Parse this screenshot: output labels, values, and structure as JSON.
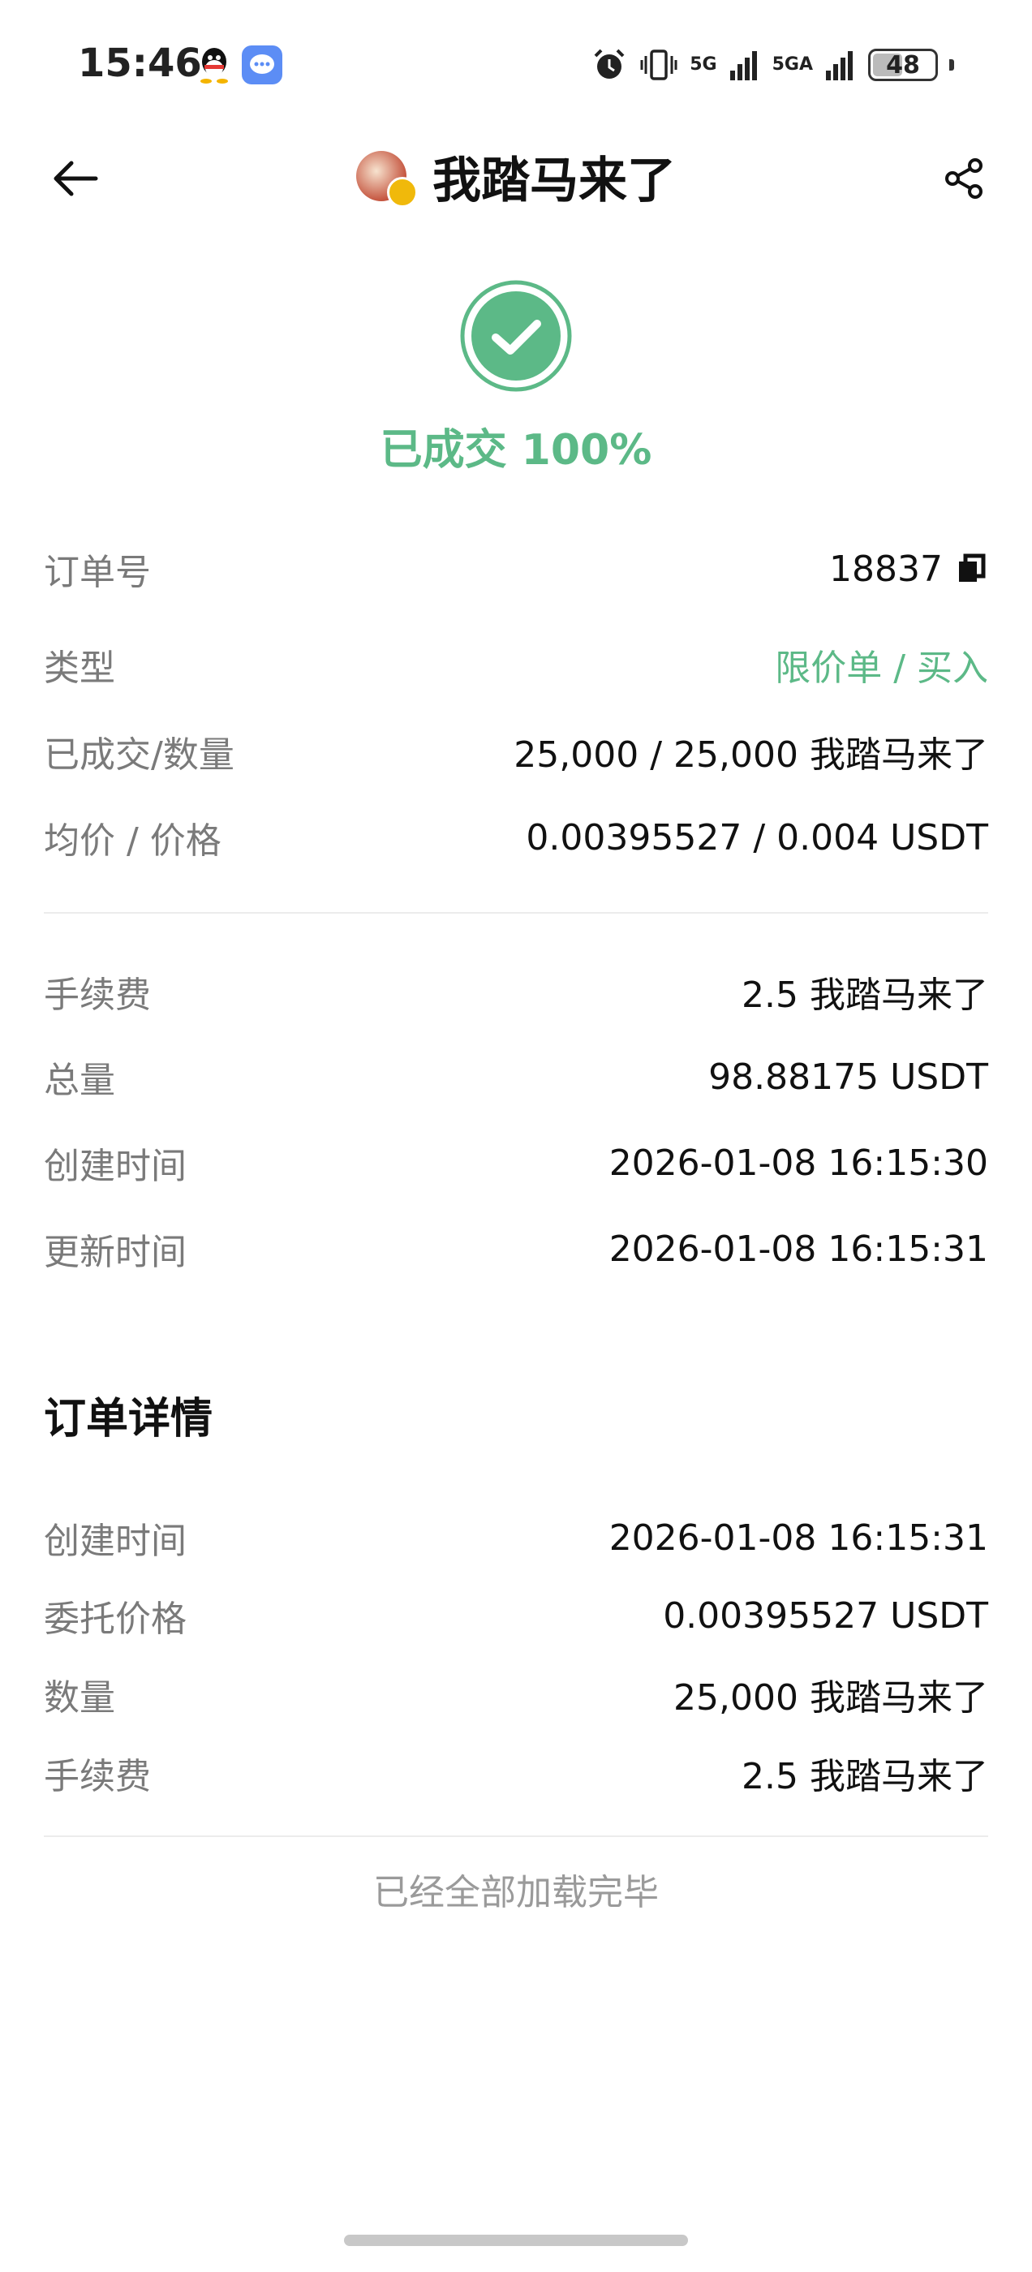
{
  "status_bar": {
    "time": "15:46",
    "net1": "5G",
    "net2": "5GA",
    "battery": "48",
    "battery_level": 0.48
  },
  "header": {
    "title": "我踏马来了"
  },
  "order_status": {
    "label": "已成交",
    "percent": "100%",
    "color": "#5cb987"
  },
  "summary": {
    "order_no_label": "订单号",
    "order_no": "18837",
    "type_label": "类型",
    "type_value": "限价单 / 买入",
    "filled_label": "已成交/数量",
    "filled_value": "25,000 / 25,000 我踏马来了",
    "avg_price_label": "均价 / 价格",
    "avg_price_value": "0.00395527 / 0.004 USDT",
    "fee_label": "手续费",
    "fee_value": "2.5 我踏马来了",
    "total_label": "总量",
    "total_value": "98.88175 USDT",
    "created_label": "创建时间",
    "created_value": "2026-01-08 16:15:30",
    "updated_label": "更新时间",
    "updated_value": "2026-01-08 16:15:31"
  },
  "details": {
    "title": "订单详情",
    "created_label": "创建时间",
    "created_value": "2026-01-08 16:15:31",
    "price_label": "委托价格",
    "price_value": "0.00395527 USDT",
    "qty_label": "数量",
    "qty_value": "25,000 我踏马来了",
    "fee_label": "手续费",
    "fee_value": "2.5 我踏马来了"
  },
  "footer": {
    "loaded_text": "已经全部加载完毕"
  }
}
